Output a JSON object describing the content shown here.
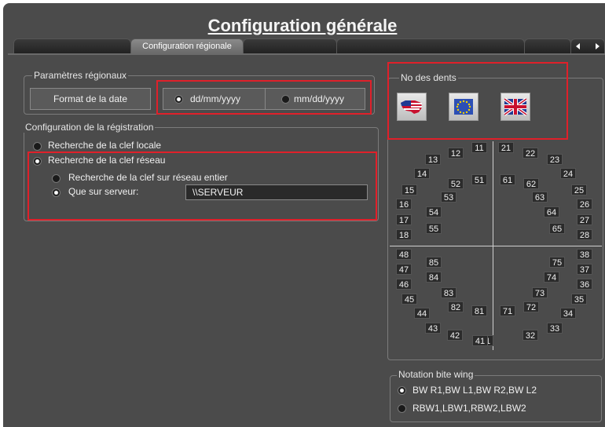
{
  "window": {
    "title": "Configuration générale"
  },
  "tabs": [
    {
      "label": ""
    },
    {
      "label": "Configuration régionale"
    },
    {
      "label": ""
    },
    {
      "label": ""
    },
    {
      "label": ""
    },
    {
      "label": ""
    }
  ],
  "regional": {
    "group_label": "Paramètres régionaux",
    "date_format_label": "Format de la date",
    "options": [
      {
        "label": "dd/mm/yyyy",
        "selected": true
      },
      {
        "label": "mm/dd/yyyy",
        "selected": false
      }
    ]
  },
  "registration": {
    "group_label": "Configuration de la régistration",
    "local_search": "Recherche de la clef locale",
    "network_search": "Recherche de la clef réseau",
    "whole_network": "Recherche de la clef sur réseau entier",
    "server_only": "Que sur serveur:",
    "server_value": "\\\\SERVEUR"
  },
  "teeth_panel": {
    "group_label": "No des dents",
    "flags": [
      "us-flag-icon",
      "eu-flag-icon",
      "uk-flag-icon"
    ],
    "teeth": [
      "11",
      "12",
      "13",
      "14",
      "15",
      "16",
      "17",
      "18",
      "21",
      "22",
      "23",
      "24",
      "25",
      "26",
      "27",
      "28",
      "31",
      "32",
      "33",
      "34",
      "35",
      "36",
      "37",
      "38",
      "41",
      "42",
      "43",
      "44",
      "45",
      "46",
      "47",
      "48",
      "51",
      "52",
      "53",
      "54",
      "55",
      "61",
      "62",
      "63",
      "64",
      "65",
      "71",
      "72",
      "73",
      "74",
      "75",
      "81",
      "82",
      "83",
      "84",
      "85"
    ]
  },
  "bitewing": {
    "group_label": "Notation bite wing",
    "options": [
      {
        "label": "BW R1,BW L1,BW R2,BW L2",
        "selected": true
      },
      {
        "label": "RBW1,LBW1,RBW2,LBW2",
        "selected": false
      }
    ]
  },
  "colors": {
    "highlight": "#e0202a",
    "panel": "#4b4b4b"
  }
}
